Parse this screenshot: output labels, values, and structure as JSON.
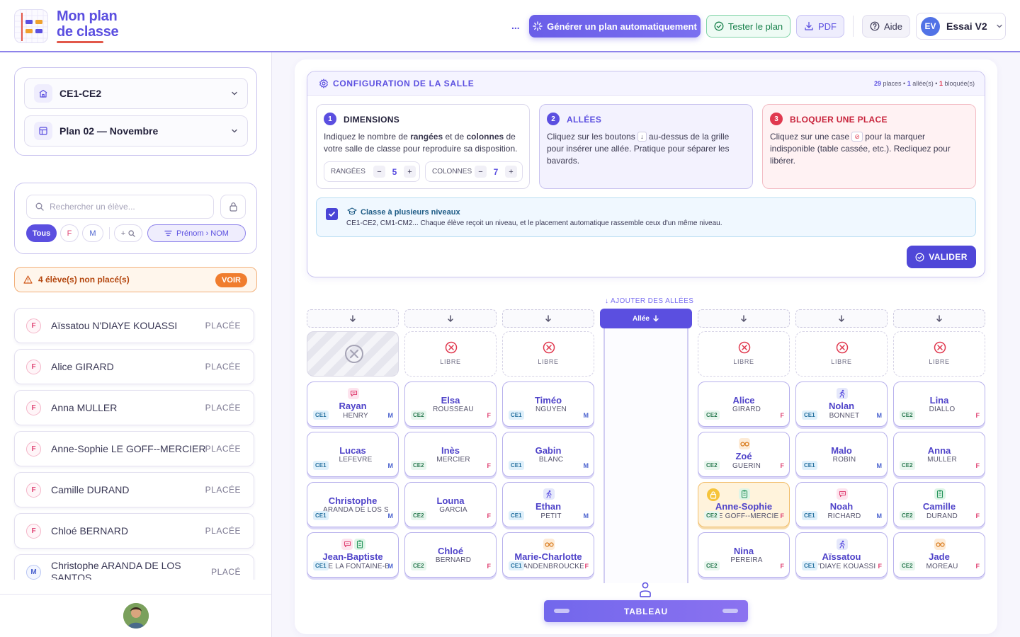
{
  "header": {
    "logo_line1": "Mon plan",
    "logo_line2": "de classe",
    "more_dots": "...",
    "generate_label": "Générer un plan automatiquement",
    "test_label": "Tester le plan",
    "pdf_label": "PDF",
    "help_label": "Aide",
    "user_initials": "EV",
    "user_name": "Essai V2"
  },
  "sidebar": {
    "class_select": "CE1-CE2",
    "plan_select": "Plan 02 — Novembre",
    "search_placeholder": "Rechercher un élève...",
    "filters": {
      "all": "Tous",
      "f": "F",
      "m": "M",
      "plus": "+",
      "sort": "Prénom › NOM"
    },
    "warning_text": "4 élève(s) non placé(s)",
    "warning_button": "VOIR",
    "students": [
      {
        "sex": "F",
        "name": "Aïssatou N'DIAYE KOUASSI",
        "status": "PLACÉE"
      },
      {
        "sex": "F",
        "name": "Alice GIRARD",
        "status": "PLACÉE"
      },
      {
        "sex": "F",
        "name": "Anna MULLER",
        "status": "PLACÉE"
      },
      {
        "sex": "F",
        "name": "Anne-Sophie LE GOFF--MERCIER",
        "status": "PLACÉE"
      },
      {
        "sex": "F",
        "name": "Camille DURAND",
        "status": "PLACÉE"
      },
      {
        "sex": "F",
        "name": "Chloé BERNARD",
        "status": "PLACÉE"
      },
      {
        "sex": "M",
        "name": "Christophe ARANDA DE LOS SANTOS",
        "status": "PLACÉ"
      }
    ]
  },
  "config": {
    "title": "CONFIGURATION DE LA SALLE",
    "stats_places": "29",
    "stats_places_label": "places •",
    "stats_allees": "1",
    "stats_allees_label": "allée(s) •",
    "stats_blocked": "1",
    "stats_blocked_label": "bloquée(s)",
    "dim_num": "1",
    "dim_title": "DIMENSIONS",
    "dim_text_a": "Indiquez le nombre de ",
    "dim_text_b": "rangées",
    "dim_text_c": " et de ",
    "dim_text_d": "colonnes",
    "dim_text_e": " de votre salle de classe pour reproduire sa disposition.",
    "rows_label": "RANGÉES",
    "rows_value": "5",
    "cols_label": "COLONNES",
    "cols_value": "7",
    "minus": "−",
    "plus": "+",
    "allees_num": "2",
    "allees_title": "ALLÉES",
    "allees_text_a": "Cliquez sur les boutons ",
    "allees_icon": "↓",
    "allees_text_b": " au-dessus de la grille pour insérer une allée. Pratique pour séparer les bavards.",
    "block_num": "3",
    "block_title": "BLOQUER UNE PLACE",
    "block_text_a": "Cliquez sur une case ",
    "block_icon": "⊘",
    "block_text_b": " pour la marquer indisponible (table cassée, etc.). Recliquez pour libérer.",
    "multi_title": "Classe à plusieurs niveaux",
    "multi_text": "CE1-CE2, CM1-CM2... Chaque élève reçoit un niveau, et le placement automatique rassemble ceux d'un même niveau.",
    "validate_label": "VALIDER"
  },
  "grid": {
    "add_allees_label": "↓ AJOUTER DES ALLÉES",
    "allee_label": "Allée",
    "libre_label": "LIBRE",
    "board_label": "TABLEAU",
    "seats": {
      "r1c1": {
        "first": "Rayan",
        "last": "HENRY",
        "level": "CE1",
        "sex": "M"
      },
      "r1c2": {
        "first": "Elsa",
        "last": "ROUSSEAU",
        "level": "CE2",
        "sex": "F"
      },
      "r1c3": {
        "first": "Timéo",
        "last": "NGUYEN",
        "level": "CE1",
        "sex": "M"
      },
      "r1c5": {
        "first": "Alice",
        "last": "GIRARD",
        "level": "CE2",
        "sex": "F"
      },
      "r1c6": {
        "first": "Nolan",
        "last": "BONNET",
        "level": "CE1",
        "sex": "M"
      },
      "r1c7": {
        "first": "Lina",
        "last": "DIALLO",
        "level": "CE2",
        "sex": "F"
      },
      "r2c1": {
        "first": "Lucas",
        "last": "LEFEVRE",
        "level": "CE1",
        "sex": "M"
      },
      "r2c2": {
        "first": "Inès",
        "last": "MERCIER",
        "level": "CE2",
        "sex": "F"
      },
      "r2c3": {
        "first": "Gabin",
        "last": "BLANC",
        "level": "CE1",
        "sex": "M"
      },
      "r2c5": {
        "first": "Zoé",
        "last": "GUERIN",
        "level": "CE2",
        "sex": "F"
      },
      "r2c6": {
        "first": "Malo",
        "last": "ROBIN",
        "level": "CE1",
        "sex": "M"
      },
      "r2c7": {
        "first": "Anna",
        "last": "MULLER",
        "level": "CE2",
        "sex": "F"
      },
      "r3c1": {
        "first": "Christophe",
        "last": "ARANDA DE LOS SANTOS",
        "level": "CE1",
        "sex": "M"
      },
      "r3c2": {
        "first": "Louna",
        "last": "GARCIA",
        "level": "CE2",
        "sex": "F"
      },
      "r3c3": {
        "first": "Ethan",
        "last": "PETIT",
        "level": "CE1",
        "sex": "M"
      },
      "r3c5": {
        "first": "Anne-Sophie",
        "last": "LE GOFF--MERCIER",
        "level": "CE2",
        "sex": "F"
      },
      "r3c6": {
        "first": "Noah",
        "last": "RICHARD",
        "level": "CE1",
        "sex": "M"
      },
      "r3c7": {
        "first": "Camille",
        "last": "DURAND",
        "level": "CE2",
        "sex": "F"
      },
      "r4c1": {
        "first": "Jean-Baptiste",
        "last": "DE LA FONTAINE-BERTRAND",
        "level": "CE1",
        "sex": "M"
      },
      "r4c2": {
        "first": "Chloé",
        "last": "BERNARD",
        "level": "CE2",
        "sex": "F"
      },
      "r4c3": {
        "first": "Marie-Charlotte",
        "last": "VANDENBROUCKE-LEMOINE",
        "level": "CE1",
        "sex": "F"
      },
      "r4c5": {
        "first": "Nina",
        "last": "PEREIRA",
        "level": "CE2",
        "sex": "F"
      },
      "r4c6": {
        "first": "Aïssatou",
        "last": "N'DIAYE KOUASSI",
        "level": "CE1",
        "sex": "F"
      },
      "r4c7": {
        "first": "Jade",
        "last": "MOREAU",
        "level": "CE2",
        "sex": "F"
      }
    }
  },
  "colors": {
    "accent": "#5b4fe0",
    "warning": "#f07d2e",
    "danger": "#e0394f",
    "success": "#17804b"
  }
}
